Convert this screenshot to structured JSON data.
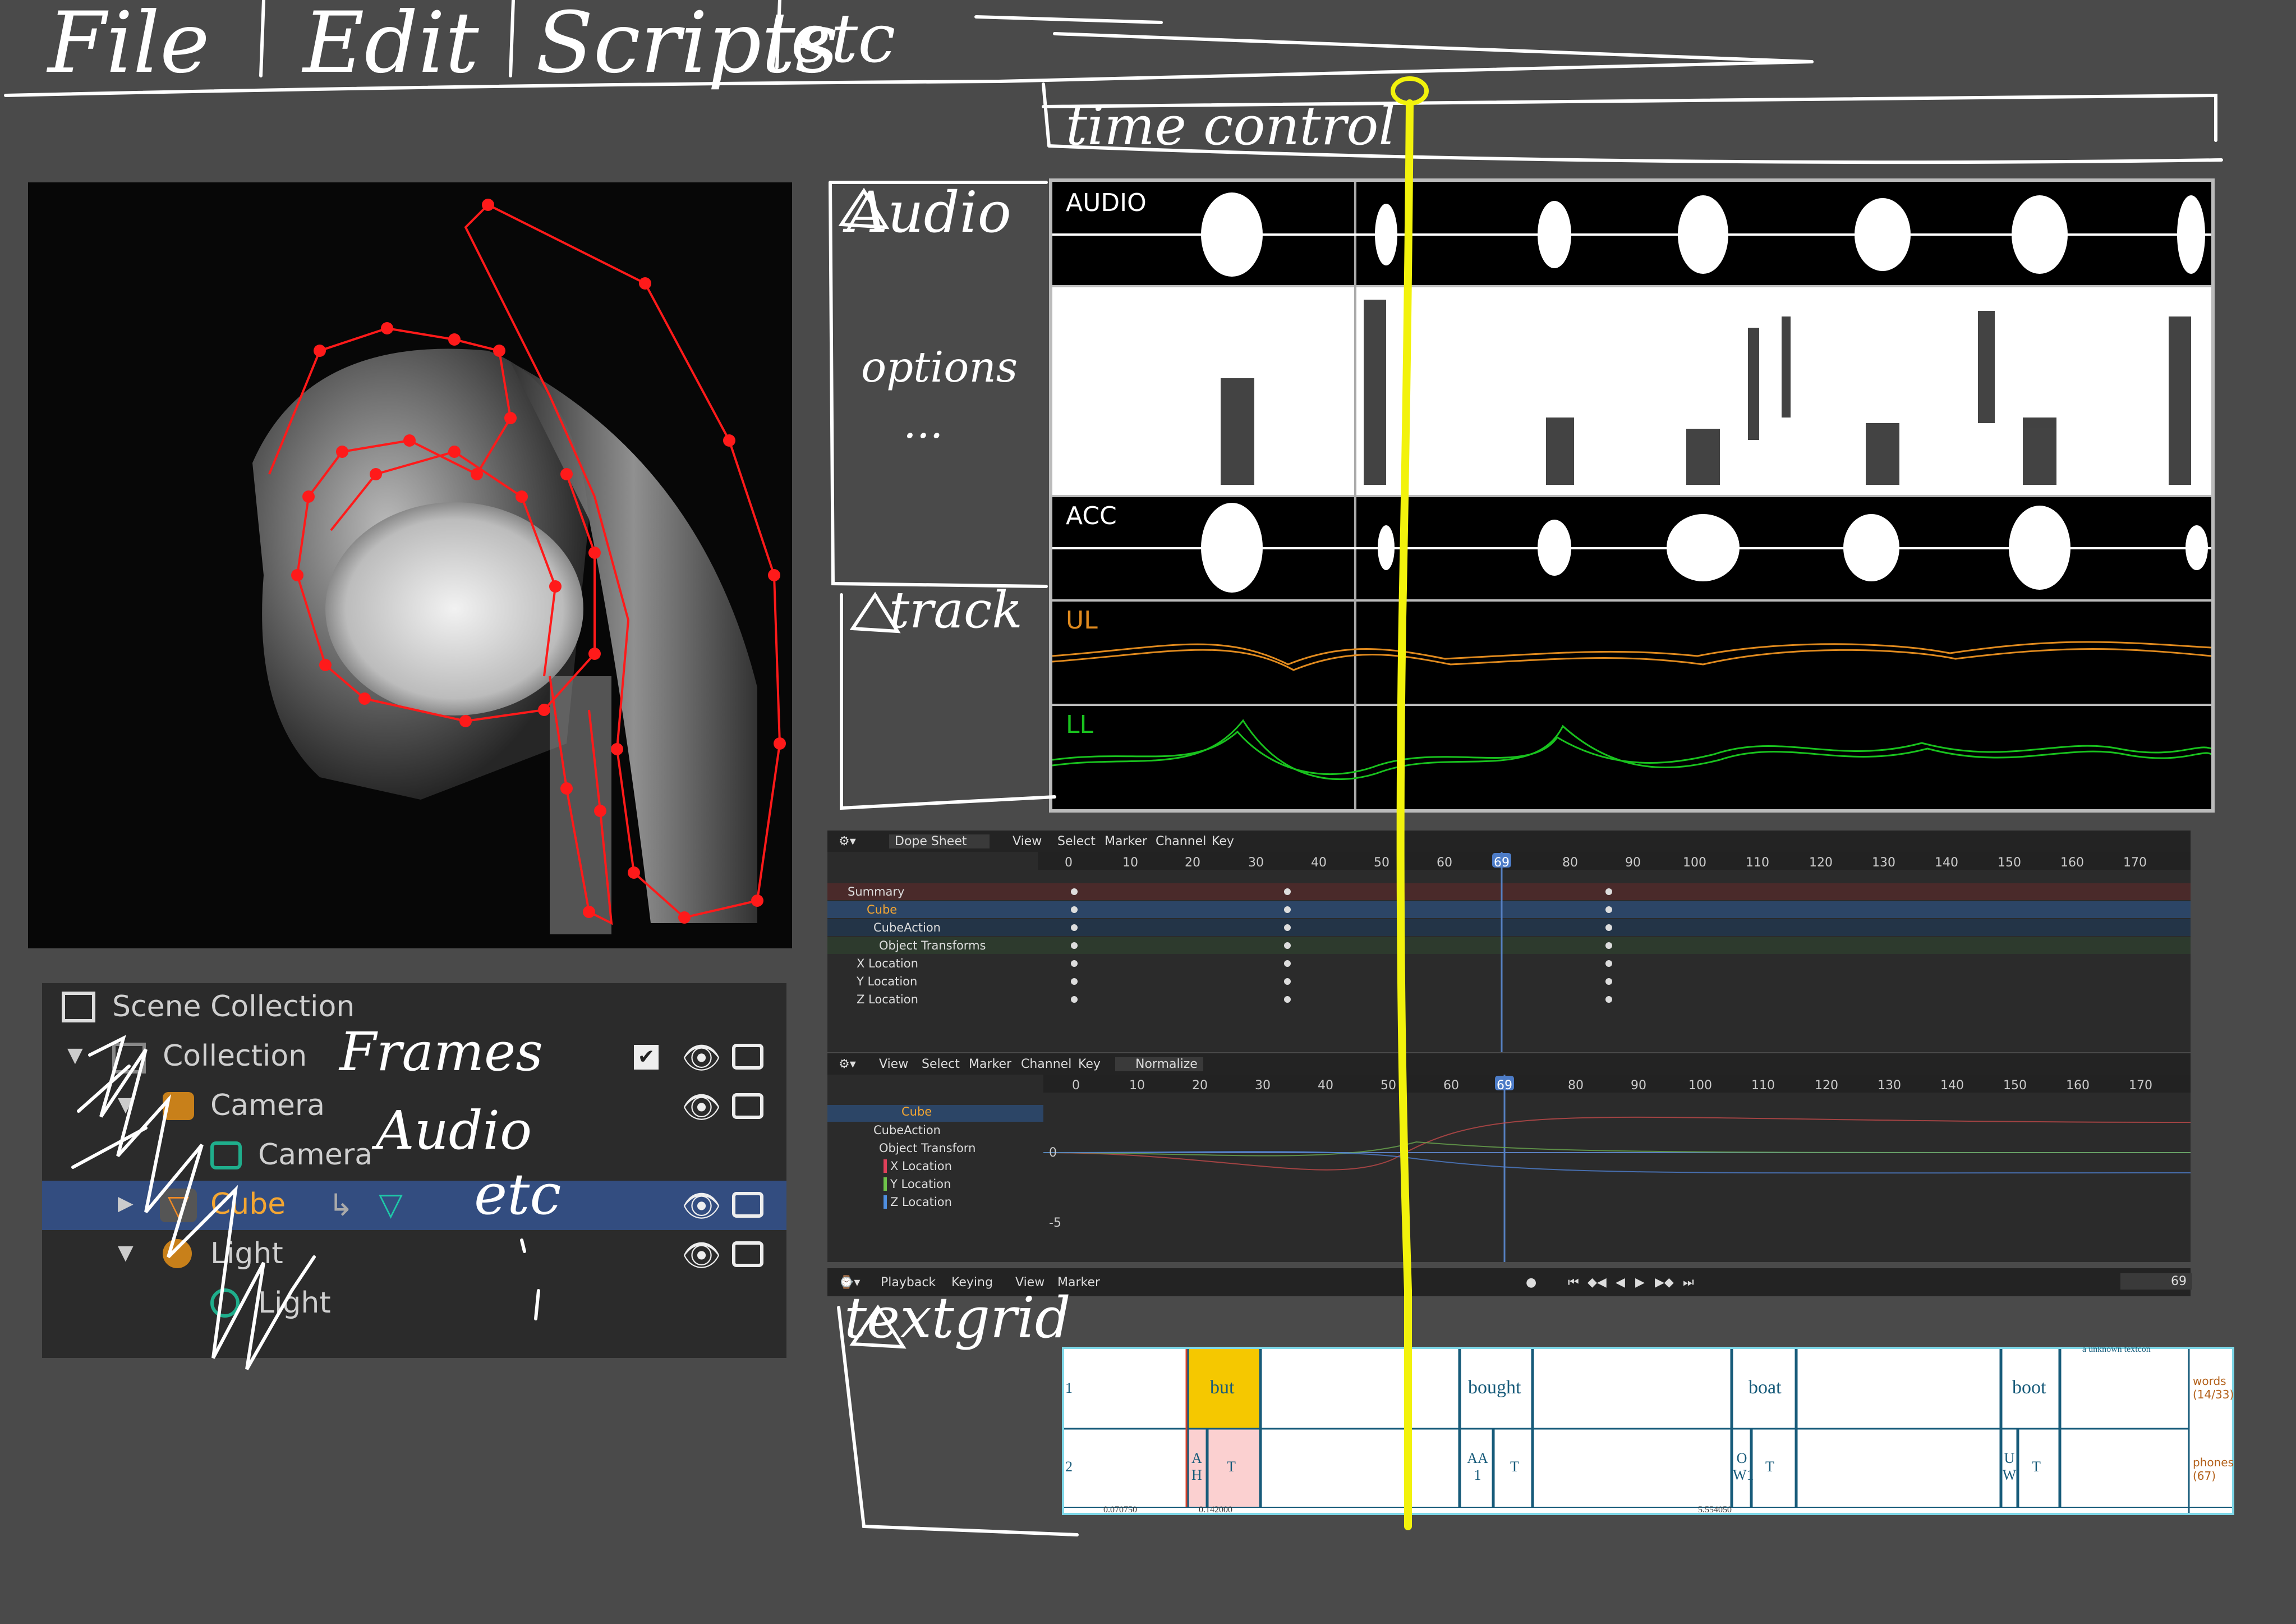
{
  "menu_bar": {
    "items": [
      "File",
      "Edit",
      "Scripts",
      "etc"
    ]
  },
  "time_control": {
    "label": "time control"
  },
  "audio_panel": {
    "label": "Audio",
    "options_label": "options",
    "options_ellipsis": "...",
    "track_label": "track",
    "signals": [
      "AUDIO",
      "ACC",
      "UL",
      "LL"
    ],
    "colors": {
      "UL": "#e08a1e",
      "LL": "#19c21e"
    }
  },
  "outliner": {
    "scene_collection": "Scene Collection",
    "collection": "Collection",
    "camera": "Camera",
    "camera_data": "Camera",
    "cube": "Cube",
    "light": "Light",
    "light_data": "Light",
    "annotation_frames": "Frames",
    "annotation_audio": "Audio",
    "annotation_etc": "etc"
  },
  "dope_sheet": {
    "editor": "Dope Sheet",
    "menus": [
      "View",
      "Select",
      "Marker",
      "Channel",
      "Key"
    ],
    "ruler": [
      "0",
      "10",
      "20",
      "30",
      "40",
      "50",
      "60",
      "69",
      "80",
      "90",
      "100",
      "110",
      "120",
      "130",
      "140",
      "150",
      "160",
      "170"
    ],
    "channels": [
      "Summary",
      "Cube",
      "CubeAction",
      "Object Transforms",
      "X Location",
      "Y Location",
      "Z Location"
    ]
  },
  "graph_editor": {
    "menus": [
      "View",
      "Select",
      "Marker",
      "Channel",
      "Key"
    ],
    "normalize": "Normalize",
    "ruler": [
      "0",
      "10",
      "20",
      "30",
      "40",
      "50",
      "60",
      "69",
      "80",
      "90",
      "100",
      "110",
      "120",
      "130",
      "140",
      "150",
      "160",
      "170"
    ],
    "channels": [
      "Cube",
      "CubeAction",
      "Object Transforn",
      "X Location",
      "Y Location",
      "Z Location"
    ],
    "y_ticks": [
      "0",
      "-5"
    ]
  },
  "timeline": {
    "menus": [
      "Playback",
      "Keying",
      "View",
      "Marker"
    ],
    "current_frame": "69"
  },
  "textgrid": {
    "label": "textgrid",
    "tier_numbers": [
      "1",
      "2"
    ],
    "words": [
      "but",
      "bought",
      "boat",
      "boot"
    ],
    "phones": [
      "A H",
      "T",
      "AA 1",
      "T",
      "O W1",
      "T",
      "U W",
      "T"
    ],
    "tier_names": [
      "words (14/33)",
      "phones (67)"
    ],
    "footer_times": [
      "0.070750",
      "0.142000",
      "5.554050"
    ],
    "header_fragment": "a unknown textcon"
  },
  "colors": {
    "background": "#4a4a4a",
    "playhead": "#f2f20c",
    "contour": "#ff1a1a",
    "blender_selected": "#334d80",
    "textgrid_word_highlight": "#f5c800"
  }
}
